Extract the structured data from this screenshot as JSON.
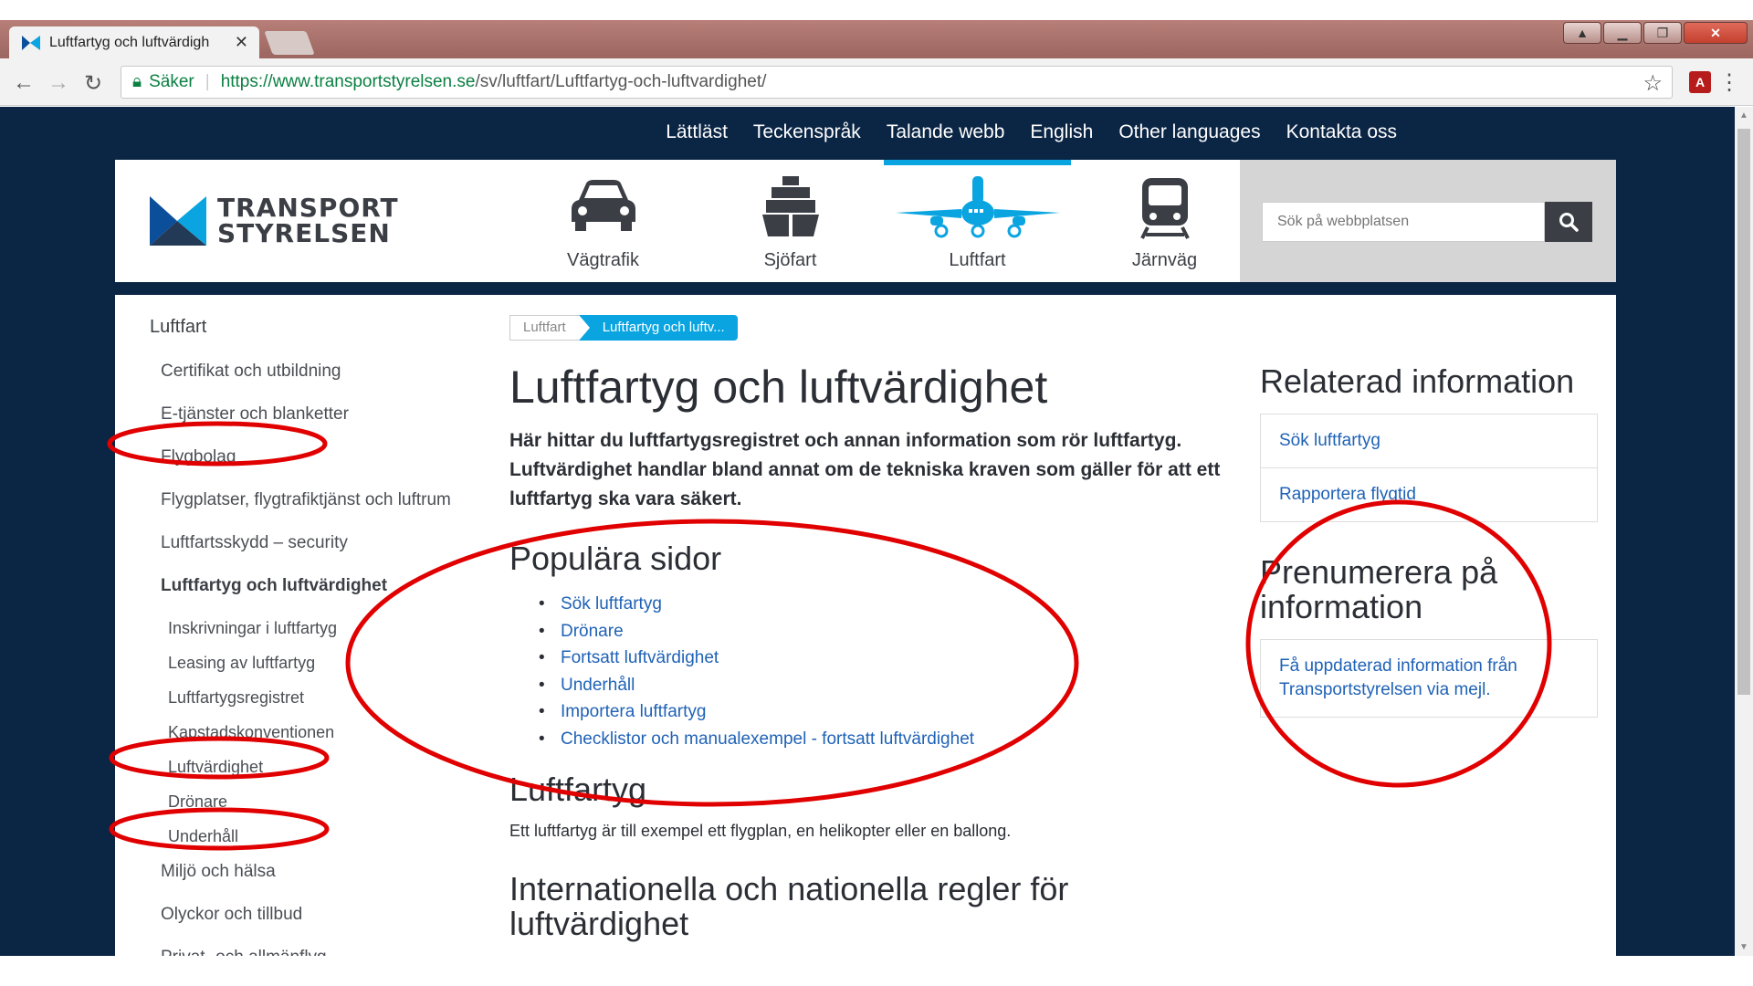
{
  "browser": {
    "tab_title": "Luftfartyg och luftvärdigh",
    "secure_label": "Säker",
    "url_main": "https://www.transportstyrelsen.se",
    "url_path": "/sv/luftfart/Luftfartyg-och-luftvardighet/"
  },
  "site": {
    "top_links": [
      "Lättläst",
      "Teckenspråk",
      "Talande webb",
      "English",
      "Other languages",
      "Kontakta oss"
    ],
    "logo_line1": "TRANSPORT",
    "logo_line2": "STYRELSEN",
    "categories": [
      {
        "label": "Vägtrafik",
        "icon": "car-icon"
      },
      {
        "label": "Sjöfart",
        "icon": "ship-icon"
      },
      {
        "label": "Luftfart",
        "icon": "airplane-icon",
        "active": true
      },
      {
        "label": "Järnväg",
        "icon": "train-icon"
      }
    ],
    "search_placeholder": "Sök på webbplatsen"
  },
  "sidenav": {
    "heading": "Luftfart",
    "items": [
      "Certifikat och utbildning",
      "E-tjänster och blanketter",
      "Flygbolag",
      "Flygplatser, flygtrafiktjänst och luftrum",
      "Luftfartsskydd – security",
      "Luftfartyg och luftvärdighet",
      "Inskrivningar i luftfartyg",
      "Leasing av luftfartyg",
      "Luftfartygsregistret",
      "Kapstadskonventionen",
      "Luftvärdighet",
      "Drönare",
      "Underhåll",
      "Miljö och hälsa",
      "Olyckor och tillbud",
      "Privat- och allmänflyg"
    ]
  },
  "breadcrumb": {
    "first": "Luftfart",
    "current": "Luftfartyg och luftv..."
  },
  "main": {
    "title": "Luftfartyg och luftvärdighet",
    "intro": "Här hittar du luftfartygsregistret och annan information som rör luftfartyg. Luftvärdighet handlar bland annat om de tekniska kraven som gäller för att ett luftfartyg ska vara säkert.",
    "popular_heading": "Populära sidor",
    "popular_links": [
      "Sök luftfartyg",
      "Drönare",
      "Fortsatt luftvärdighet",
      "Underhåll",
      "Importera luftfartyg",
      "Checklistor och manualexempel - fortsatt luftvärdighet"
    ],
    "luftfartyg_heading": "Luftfartyg",
    "luftfartyg_text": "Ett luftfartyg är till exempel ett flygplan, en helikopter eller en ballong.",
    "regler_heading": "Internationella och nationella regler för luftvärdighet"
  },
  "aside": {
    "related_heading": "Relaterad information",
    "related_links": [
      "Sök luftfartyg",
      "Rapportera flygtid"
    ],
    "subscribe_heading": "Prenumerera på information",
    "subscribe_link": "Få uppdaterad information från Transportstyrelsen via mejl."
  },
  "colors": {
    "page_bg": "#0b2545",
    "accent": "#0aa5e0",
    "link": "#1f62b6",
    "annotation": "#e10000"
  }
}
